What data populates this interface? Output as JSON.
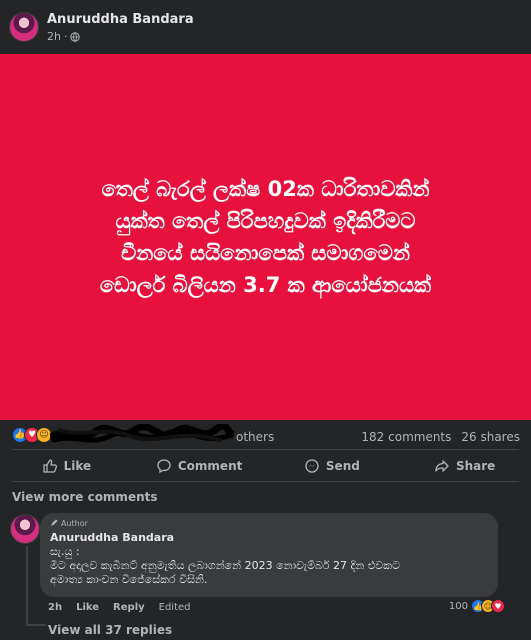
{
  "post": {
    "author": "Anuruddha Bandara",
    "time": "2h",
    "privacy_icon": "globe-icon",
    "headline_lines": [
      "තෙල් බැරල් ලක්ෂ 02ක ධාරිතාවකින්",
      "යුක්ත තෙල් පිරිපහදුවක් ඉදිකිරීමට",
      "චීනයේ සයිනොපෙක් සමාගමෙන්",
      "ඩොලර් බිලියන 3.7 ක ආයෝජනයක්"
    ],
    "media_background": "#e8103c"
  },
  "reactions": {
    "icons": [
      "like-icon",
      "love-icon",
      "haha-icon"
    ],
    "others_text": "others",
    "comments_count": "182 comments",
    "shares_count": "26 shares"
  },
  "actions": {
    "like": "Like",
    "comment": "Comment",
    "send": "Send",
    "share": "Share"
  },
  "view_more_comments": "View more comments",
  "comment": {
    "badge": "Author",
    "author": "Anuruddha Bandara",
    "text_lines": [
      "සැ.යු :",
      "මීට අදාලව කැබිනට් අනුමැතිය ලබාගන්නේ 2023 නොවැම්බර් 27 දින එවකට",
      "අමාත්‍ය කාංචන විජේසේකර විසිනි."
    ],
    "time": "2h",
    "like": "Like",
    "reply": "Reply",
    "edited": "Edited",
    "reaction_count": "100"
  },
  "view_replies": "View all 37 replies",
  "colors": {
    "background": "#242526",
    "bubble": "#3a3b3c",
    "accent_like": "#1877f2",
    "accent_love": "#f02849",
    "accent_haha": "#f7b125"
  }
}
